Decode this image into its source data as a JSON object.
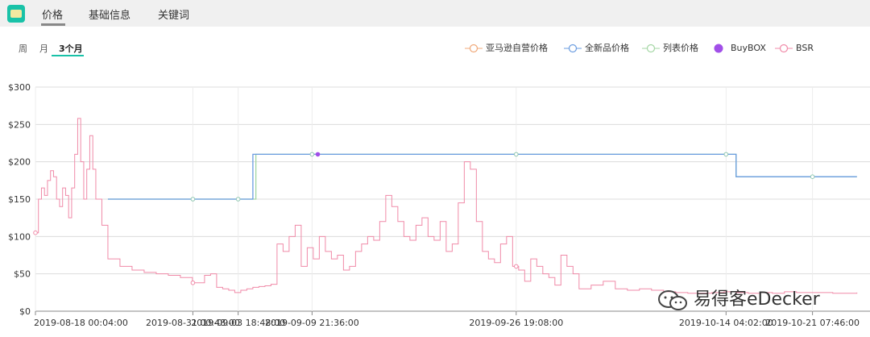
{
  "tabs": [
    {
      "label": "价格",
      "active": true
    },
    {
      "label": "基础信息",
      "active": false
    },
    {
      "label": "关键词",
      "active": false
    }
  ],
  "range_buttons": [
    {
      "label": "周",
      "active": false
    },
    {
      "label": "月",
      "active": false
    },
    {
      "label": "3个月",
      "active": true
    }
  ],
  "legend": [
    {
      "label": "亚马逊自营价格",
      "color": "#f0a878",
      "marker": "hollow"
    },
    {
      "label": "全新品价格",
      "color": "#6a9ce0",
      "marker": "hollow"
    },
    {
      "label": "列表价格",
      "color": "#a3d6a3",
      "marker": "hollow"
    },
    {
      "label": "BuyBOX",
      "color": "#a14fe8",
      "marker": "filled"
    },
    {
      "label": "BSR",
      "color": "#f08aa8",
      "marker": "hollow"
    }
  ],
  "watermark": {
    "text": "易得客eDecker"
  },
  "chart_data": {
    "type": "line",
    "x_ticks": [
      "2019-08-18 00:04:00",
      "2019-08-31 00:48:00",
      "2019-09-03 18:48:00",
      "2019-09-09 21:36:00",
      "2019-09-26 19:08:00",
      "2019-10-14 04:02:00",
      "2019-10-21 07:46:00"
    ],
    "y_ticks": [
      "$0",
      "$50",
      "$100",
      "$150",
      "$200",
      "$250",
      "$300"
    ],
    "ylim": [
      0,
      300
    ],
    "grid": true,
    "legend_position": "top-right",
    "series": [
      {
        "name": "全新品价格",
        "step": true,
        "x": [
          "2019-08-24",
          "2019-08-31 00:48",
          "2019-09-03 18:48",
          "2019-09-05",
          "2019-09-05",
          "2019-09-09 21:36",
          "2019-09-26 19:08",
          "2019-10-14 04:02",
          "2019-10-15",
          "2019-10-15",
          "2019-10-21 07:46",
          "2019-10-25"
        ],
        "values": [
          150,
          150,
          150,
          150,
          210,
          210,
          210,
          210,
          210,
          180,
          180,
          180
        ]
      },
      {
        "name": "列表价格",
        "step": true,
        "x": [
          "2019-08-24",
          "2019-08-31 00:48",
          "2019-09-03 18:48",
          "2019-09-05 06:00",
          "2019-09-05 06:00",
          "2019-09-09 21:36",
          "2019-09-26 19:08",
          "2019-10-14 04:02",
          "2019-10-15",
          "2019-10-15",
          "2019-10-21 07:46",
          "2019-10-25"
        ],
        "values": [
          150,
          150,
          150,
          150,
          210,
          210,
          210,
          210,
          210,
          180,
          180,
          180
        ]
      },
      {
        "name": "BuyBOX",
        "x": [
          "2019-09-10 09:00"
        ],
        "values": [
          210
        ]
      },
      {
        "name": "BSR",
        "step": true,
        "x": [
          "2019-08-18 00:04",
          "2019-08-18 06:00",
          "2019-08-18 12:00",
          "2019-08-18 18:00",
          "2019-08-19 00:00",
          "2019-08-19 06:00",
          "2019-08-19 12:00",
          "2019-08-19 18:00",
          "2019-08-20 00:00",
          "2019-08-20 06:00",
          "2019-08-20 12:00",
          "2019-08-20 18:00",
          "2019-08-21 00:00",
          "2019-08-21 06:00",
          "2019-08-21 12:00",
          "2019-08-21 18:00",
          "2019-08-22 00:00",
          "2019-08-22 06:00",
          "2019-08-22 12:00",
          "2019-08-22 18:00",
          "2019-08-23 00:00",
          "2019-08-23 12:00",
          "2019-08-24 00:00",
          "2019-08-25 00:00",
          "2019-08-26 00:00",
          "2019-08-27 00:00",
          "2019-08-28 00:00",
          "2019-08-29 00:00",
          "2019-08-30 00:00",
          "2019-08-31 00:00",
          "2019-09-01 00:00",
          "2019-09-01 12:00",
          "2019-09-02 00:00",
          "2019-09-02 12:00",
          "2019-09-03 00:00",
          "2019-09-03 12:00",
          "2019-09-04 00:00",
          "2019-09-04 12:00",
          "2019-09-05 00:00",
          "2019-09-05 12:00",
          "2019-09-06 00:00",
          "2019-09-06 12:00",
          "2019-09-07 00:00",
          "2019-09-07 12:00",
          "2019-09-08 00:00",
          "2019-09-08 12:00",
          "2019-09-09 00:00",
          "2019-09-09 12:00",
          "2019-09-10 00:00",
          "2019-09-10 12:00",
          "2019-09-11 00:00",
          "2019-09-11 12:00",
          "2019-09-12 00:00",
          "2019-09-12 12:00",
          "2019-09-13 00:00",
          "2019-09-13 12:00",
          "2019-09-14 00:00",
          "2019-09-14 12:00",
          "2019-09-15 00:00",
          "2019-09-15 12:00",
          "2019-09-16 00:00",
          "2019-09-16 12:00",
          "2019-09-17 00:00",
          "2019-09-17 12:00",
          "2019-09-18 00:00",
          "2019-09-18 12:00",
          "2019-09-19 00:00",
          "2019-09-19 12:00",
          "2019-09-20 00:00",
          "2019-09-20 12:00",
          "2019-09-21 00:00",
          "2019-09-21 12:00",
          "2019-09-22 00:00",
          "2019-09-22 12:00",
          "2019-09-23 00:00",
          "2019-09-23 12:00",
          "2019-09-24 00:00",
          "2019-09-24 12:00",
          "2019-09-25 00:00",
          "2019-09-25 12:00",
          "2019-09-26 00:00",
          "2019-09-26 12:00",
          "2019-09-27 00:00",
          "2019-09-27 12:00",
          "2019-09-28 00:00",
          "2019-09-28 12:00",
          "2019-09-29 00:00",
          "2019-09-29 12:00",
          "2019-09-30 00:00",
          "2019-09-30 12:00",
          "2019-10-01 00:00",
          "2019-10-01 12:00",
          "2019-10-02 00:00",
          "2019-10-03 00:00",
          "2019-10-04 00:00",
          "2019-10-05 00:00",
          "2019-10-06 00:00",
          "2019-10-07 00:00",
          "2019-10-08 00:00",
          "2019-10-09 00:00",
          "2019-10-10 00:00",
          "2019-10-11 00:00",
          "2019-10-12 00:00",
          "2019-10-13 00:00",
          "2019-10-14 00:00",
          "2019-10-15 00:00",
          "2019-10-16 00:00",
          "2019-10-17 00:00",
          "2019-10-18 00:00",
          "2019-10-19 00:00",
          "2019-10-20 00:00",
          "2019-10-21 00:00",
          "2019-10-22 00:00",
          "2019-10-23 00:00",
          "2019-10-24 00:00",
          "2019-10-25 00:00"
        ],
        "values": [
          105,
          150,
          165,
          155,
          175,
          188,
          180,
          150,
          140,
          165,
          155,
          125,
          165,
          210,
          258,
          200,
          150,
          190,
          235,
          190,
          150,
          115,
          70,
          60,
          55,
          52,
          50,
          48,
          45,
          38,
          48,
          50,
          32,
          30,
          28,
          25,
          28,
          30,
          32,
          33,
          34,
          36,
          90,
          80,
          100,
          115,
          60,
          85,
          70,
          100,
          80,
          70,
          75,
          55,
          60,
          80,
          90,
          100,
          95,
          120,
          155,
          140,
          120,
          100,
          95,
          115,
          125,
          100,
          95,
          120,
          80,
          90,
          145,
          200,
          190,
          120,
          80,
          70,
          65,
          90,
          100,
          60,
          55,
          40,
          70,
          60,
          50,
          45,
          35,
          75,
          60,
          50,
          30,
          35,
          40,
          30,
          28,
          30,
          28,
          26,
          25,
          24,
          24,
          25,
          26,
          25,
          24,
          25,
          24,
          26,
          25,
          25,
          25,
          24,
          24,
          25
        ]
      }
    ]
  }
}
